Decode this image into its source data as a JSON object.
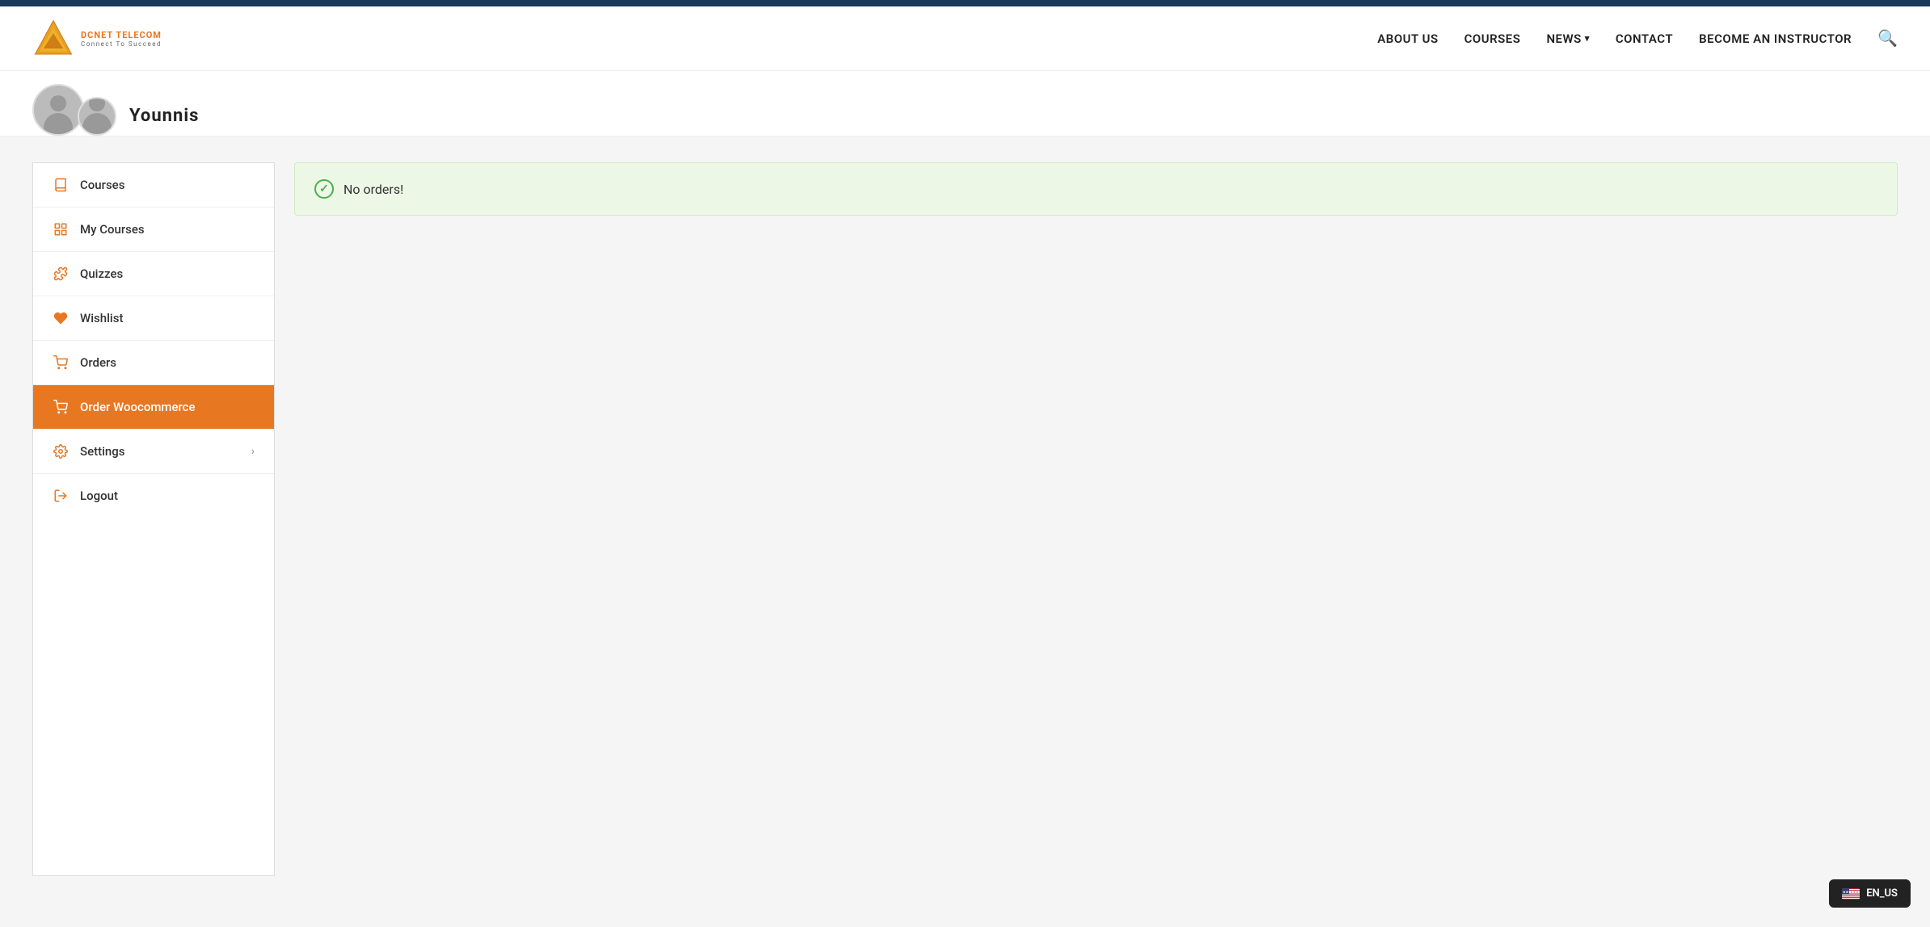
{
  "topbar": {},
  "header": {
    "logo_brand": "DCNET TELECOM",
    "logo_tagline": "Connect To Succeed",
    "nav": [
      {
        "label": "ABOUT US",
        "key": "about-us",
        "has_dropdown": false
      },
      {
        "label": "COURSES",
        "key": "courses",
        "has_dropdown": false
      },
      {
        "label": "NEWS",
        "key": "news",
        "has_dropdown": true
      },
      {
        "label": "CONTACT",
        "key": "contact",
        "has_dropdown": false
      },
      {
        "label": "BECOME AN INSTRUCTOR",
        "key": "become-instructor",
        "has_dropdown": false
      }
    ]
  },
  "profile": {
    "username": "Younnis"
  },
  "sidebar": {
    "items": [
      {
        "label": "Courses",
        "key": "courses",
        "icon": "book",
        "active": false,
        "has_chevron": false
      },
      {
        "label": "My Courses",
        "key": "my-courses",
        "icon": "grid",
        "active": false,
        "has_chevron": false
      },
      {
        "label": "Quizzes",
        "key": "quizzes",
        "icon": "puzzle",
        "active": false,
        "has_chevron": false
      },
      {
        "label": "Wishlist",
        "key": "wishlist",
        "icon": "heart",
        "active": false,
        "has_chevron": false
      },
      {
        "label": "Orders",
        "key": "orders",
        "icon": "cart",
        "active": false,
        "has_chevron": false
      },
      {
        "label": "Order Woocommerce",
        "key": "order-woocommerce",
        "icon": "cart",
        "active": true,
        "has_chevron": false
      },
      {
        "label": "Settings",
        "key": "settings",
        "icon": "gear",
        "active": false,
        "has_chevron": true
      },
      {
        "label": "Logout",
        "key": "logout",
        "icon": "logout",
        "active": false,
        "has_chevron": false
      }
    ]
  },
  "main": {
    "no_orders_message": "No orders!"
  },
  "language": {
    "code": "EN_US",
    "flag": "us"
  }
}
